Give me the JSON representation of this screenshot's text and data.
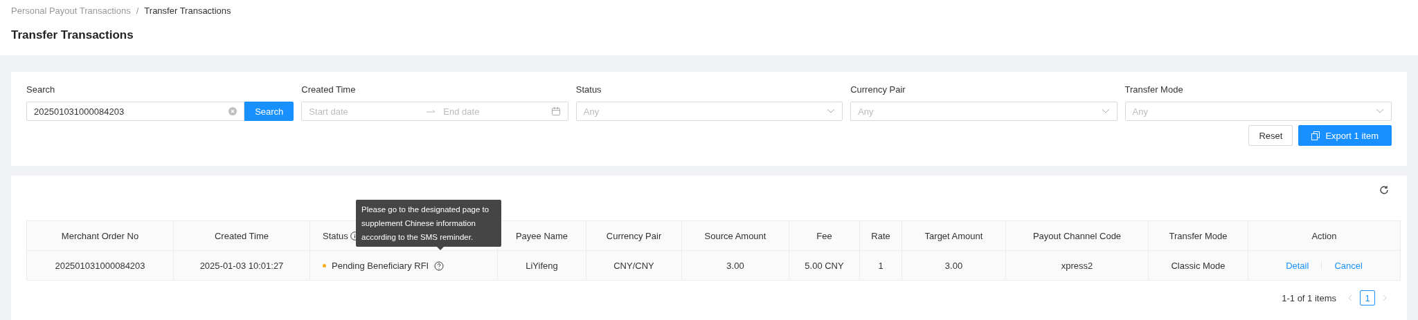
{
  "breadcrumb": [
    {
      "label": "Personal Payout Transactions",
      "current": false
    },
    {
      "label": "/",
      "current": false
    },
    {
      "label": "Transfer Transactions",
      "current": true
    }
  ],
  "page_title": "Transfer Transactions",
  "filters": [
    {
      "kind": "search",
      "label": "Search",
      "value": "202501031000084203",
      "button": "Search"
    },
    {
      "kind": "daterange",
      "label": "Created Time",
      "start_placeholder": "Start date",
      "end_placeholder": "End date"
    },
    {
      "kind": "select",
      "label": "Status",
      "placeholder": "Any"
    },
    {
      "kind": "select",
      "label": "Currency Pair",
      "placeholder": "Any"
    },
    {
      "kind": "select",
      "label": "Transfer Mode",
      "placeholder": "Any"
    }
  ],
  "filter_buttons": [
    {
      "kind": "default",
      "label": "Reset"
    },
    {
      "kind": "primary",
      "label": "Export 1 item"
    }
  ],
  "table": {
    "columns": [
      "Merchant Order No",
      "Created Time",
      "Status",
      "Payee Name",
      "Currency Pair",
      "Source Amount",
      "Fee",
      "Rate",
      "Target Amount",
      "Payout Channel Code",
      "Transfer Mode",
      "Action"
    ],
    "rows": [
      {
        "merchant_order_no": "202501031000084203",
        "created_time": "2025-01-03 10:01:27",
        "status": "Pending Beneficiary RFI",
        "color": "#faad14",
        "payee_name": "LiYifeng",
        "currency_pair": "CNY/CNY",
        "source_amount": "3.00",
        "fee": "5.00 CNY",
        "rate": "1",
        "target_amount": "3.00",
        "payout_channel_code": "xpress2",
        "transfer_mode": "Classic Mode",
        "actions": [
          "Detail",
          "Cancel"
        ]
      }
    ]
  },
  "tooltip": "Please go to the designated page to supplement Chinese information according to the SMS reminder.",
  "pagination": {
    "summary": "1-1 of 1 items",
    "pages": [
      {
        "label": "1",
        "selected": true
      }
    ]
  }
}
